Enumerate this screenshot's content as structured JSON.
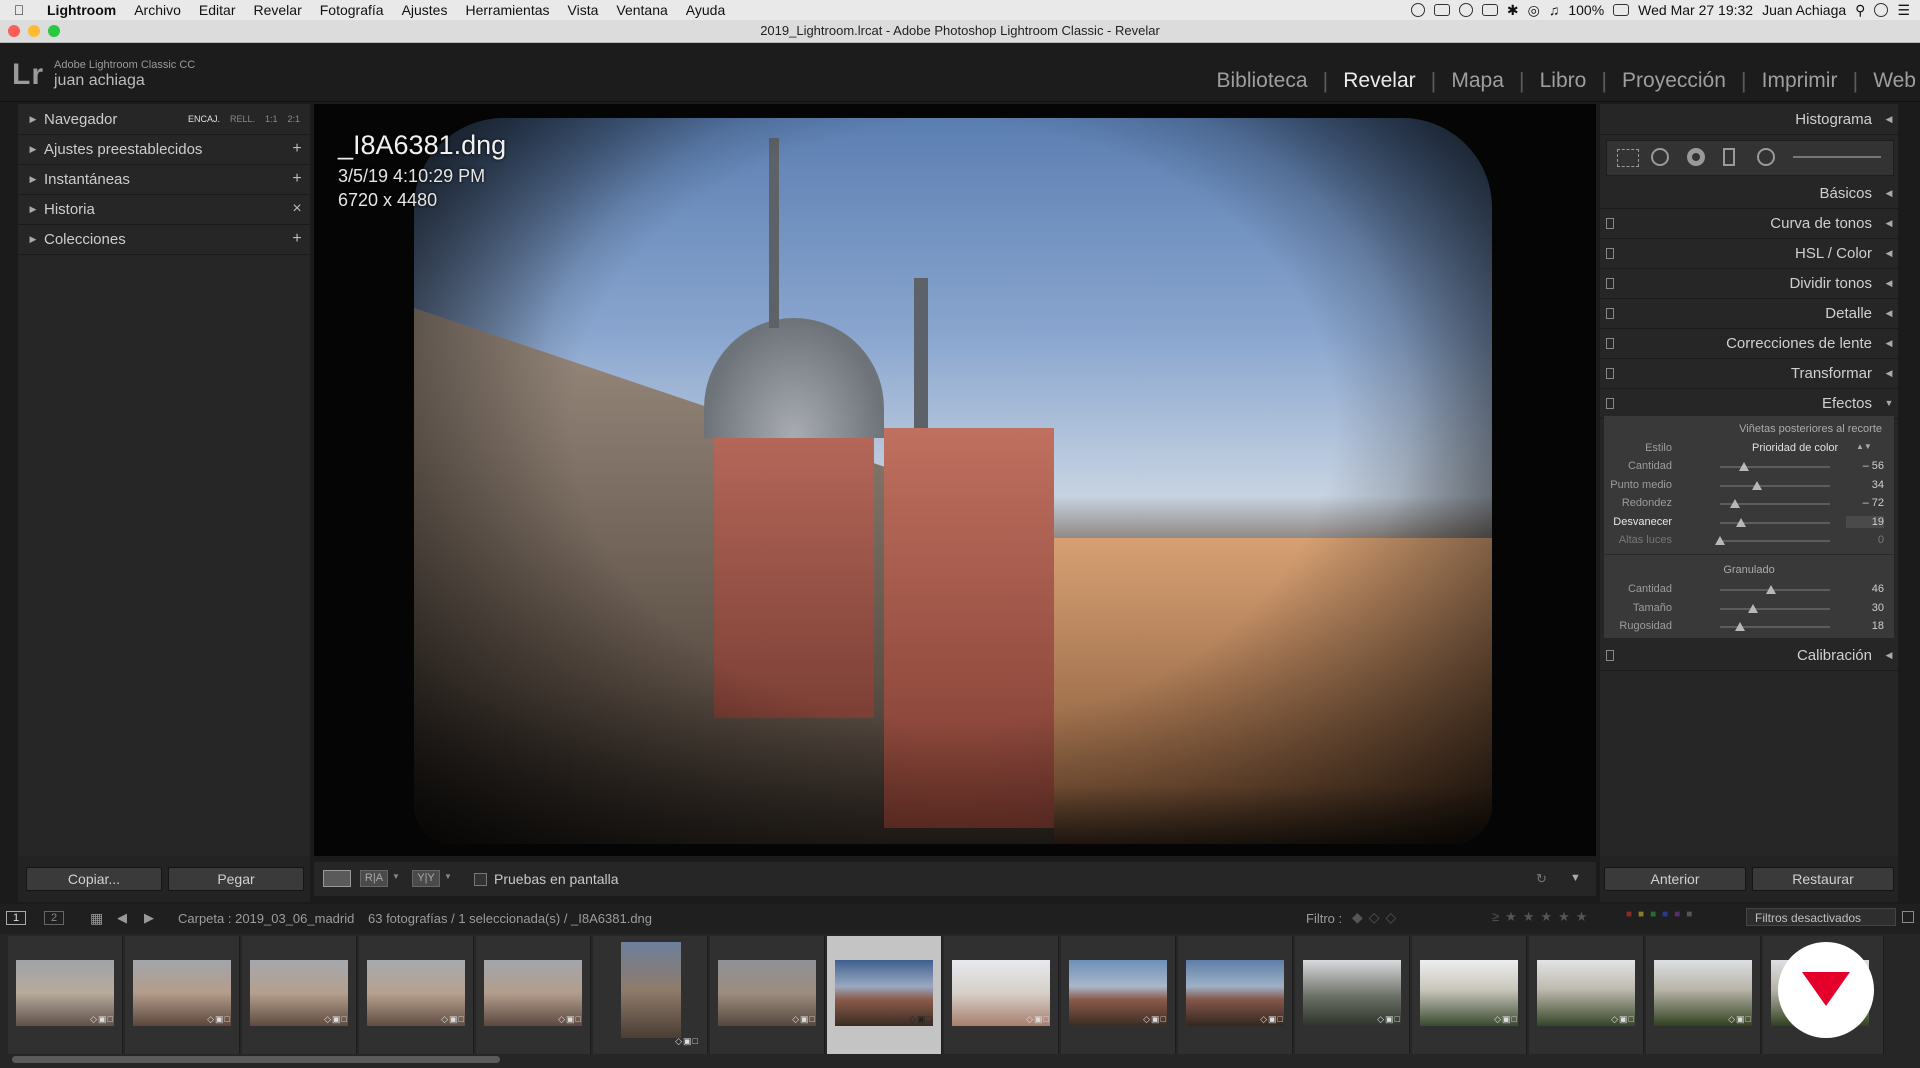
{
  "menubar": {
    "app": "Lightroom",
    "items": [
      "Archivo",
      "Editar",
      "Revelar",
      "Fotografía",
      "Ajustes",
      "Herramientas",
      "Vista",
      "Ventana",
      "Ayuda"
    ],
    "battery": "100%",
    "clock": "Wed Mar 27  19:32",
    "user": "Juan Achiaga"
  },
  "window": {
    "title": "2019_Lightroom.lrcat - Adobe Photoshop Lightroom Classic - Revelar"
  },
  "identity": {
    "logo": "Lr",
    "app_name": "Adobe Lightroom Classic CC",
    "user_name": "juan achiaga"
  },
  "modules": [
    "Biblioteca",
    "Revelar",
    "Mapa",
    "Libro",
    "Proyección",
    "Imprimir",
    "Web"
  ],
  "active_module": "Revelar",
  "left_panel": {
    "navigator": {
      "label": "Navegador",
      "zoom": [
        "ENCAJ.",
        "RELL.",
        "1:1",
        "2:1"
      ]
    },
    "items": [
      {
        "label": "Ajustes preestablecidos",
        "action": "+"
      },
      {
        "label": "Instantáneas",
        "action": "+"
      },
      {
        "label": "Historia",
        "action": "×"
      },
      {
        "label": "Colecciones",
        "action": "+"
      }
    ],
    "copy_button": "Copiar...",
    "paste_button": "Pegar"
  },
  "photo": {
    "filename": "_I8A6381.dng",
    "datetime": "3/5/19 4:10:29 PM",
    "dimensions": "6720 x 4480"
  },
  "toolbar": {
    "soft_proofing": "Pruebas en pantalla",
    "view_before_after": "R|A",
    "view_yy": "Y|Y"
  },
  "right_panel": {
    "histogram": "Histograma",
    "sections": [
      "Básicos",
      "Curva de tonos",
      "HSL / Color",
      "Dividir tonos",
      "Detalle",
      "Correcciones de lente",
      "Transformar",
      "Efectos"
    ],
    "effects": {
      "vignette_title": "Viñetas posteriores al recorte",
      "style_label": "Estilo",
      "style_value": "Prioridad de color",
      "vignette_sliders": [
        {
          "label": "Cantidad",
          "value": -56,
          "display": "– 56",
          "min": -100,
          "max": 100
        },
        {
          "label": "Punto medio",
          "value": 34,
          "display": "34",
          "min": 0,
          "max": 100
        },
        {
          "label": "Redondez",
          "value": -72,
          "display": "– 72",
          "min": -100,
          "max": 100
        },
        {
          "label": "Desvanecer",
          "value": 19,
          "display": "19",
          "min": 0,
          "max": 100
        },
        {
          "label": "Altas luces",
          "value": 0,
          "display": "0",
          "min": 0,
          "max": 100
        }
      ],
      "grain_title": "Granulado",
      "grain_sliders": [
        {
          "label": "Cantidad",
          "value": 46,
          "display": "46",
          "min": 0,
          "max": 100
        },
        {
          "label": "Tamaño",
          "value": 30,
          "display": "30",
          "min": 0,
          "max": 100
        },
        {
          "label": "Rugosidad",
          "value": 18,
          "display": "18",
          "min": 0,
          "max": 100
        }
      ]
    },
    "calibration": "Calibración",
    "previous_button": "Anterior",
    "reset_button": "Restaurar"
  },
  "filmstrip_bar": {
    "view1": "1",
    "view2": "2",
    "source": "Carpeta : 2019_03_06_madrid",
    "count": "63 fotografías / 1 seleccionada(s) / _I8A6381.dng",
    "filter_label": "Filtro :",
    "filters_off": "Filtros desactivados"
  },
  "colors": {
    "accent": "#e5002b",
    "panel": "#262626",
    "selected_thumb": "#c4c4c4"
  }
}
